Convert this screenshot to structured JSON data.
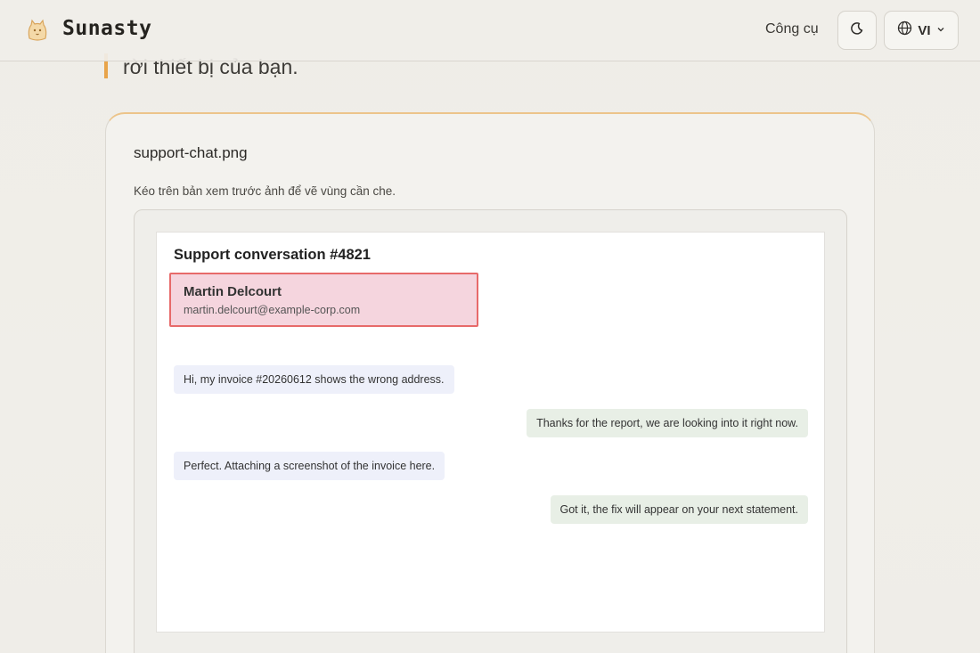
{
  "header": {
    "brand": "Sunasty",
    "tools_label": "Công cụ",
    "lang_label": "VI"
  },
  "intro": {
    "text": "rời thiết bị của bạn."
  },
  "card": {
    "file_name": "support-chat.png",
    "hint": "Kéo trên bản xem trước ảnh để vẽ vùng cần che."
  },
  "preview": {
    "title": "Support conversation #4821",
    "contact_name": "Martin Delcourt",
    "contact_email": "martin.delcourt@example-corp.com",
    "messages": [
      {
        "side": "left",
        "text": "Hi, my invoice #20260612 shows the wrong address."
      },
      {
        "side": "right",
        "text": "Thanks for the report, we are looking into it right now."
      },
      {
        "side": "left",
        "text": "Perfect. Attaching a screenshot of the invoice here."
      },
      {
        "side": "right",
        "text": "Got it, the fix will appear on your next statement."
      }
    ]
  },
  "icons": {
    "logo": "cat-logo-icon",
    "theme": "moon-icon",
    "language": "globe-icon",
    "dropdown": "chevron-down-icon"
  },
  "colors": {
    "accent": "#e8a44a",
    "redaction_fill": "#f0becd",
    "redaction_border": "#e76a6a"
  }
}
